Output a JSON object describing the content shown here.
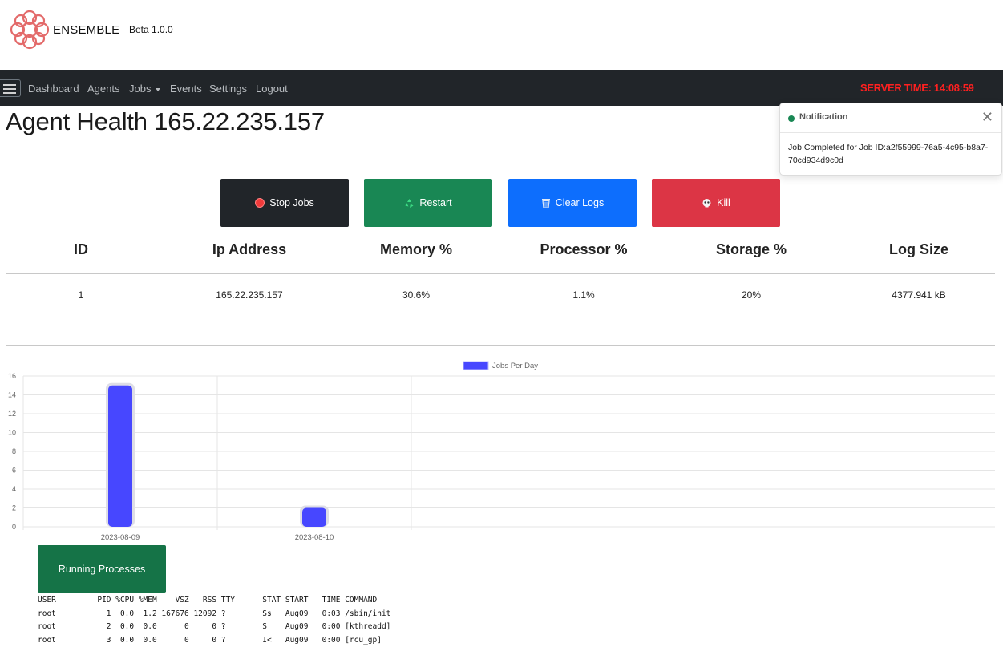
{
  "brand": {
    "name": "ENSEMBLE",
    "version": "Beta 1.0.0",
    "logo_icon": "celtic-knot-logo",
    "logo_color": "#e36a6a"
  },
  "nav": {
    "items": [
      "Dashboard",
      "Agents",
      "Jobs",
      "Events",
      "Settings",
      "Logout"
    ],
    "server_time": "SERVER TIME: 14:08:59",
    "server_time_color": "#ff2020"
  },
  "page": {
    "title": "Agent Health 165.22.235.157"
  },
  "notification": {
    "title": "Notification",
    "message": "Job Completed for Job ID:a2f55999-76a5-4c95-b8a7-70cd934d9c0d",
    "status_color": "#198754"
  },
  "actions": {
    "stop": "Stop Jobs",
    "restart": "Restart",
    "clear": "Clear Logs",
    "kill": "Kill"
  },
  "stats": {
    "headers": [
      "ID",
      "Ip Address",
      "Memory %",
      "Processor %",
      "Storage %",
      "Log Size"
    ],
    "row": [
      "1",
      "165.22.235.157",
      "30.6%",
      "1.1%",
      "20%",
      "4377.941 kB"
    ]
  },
  "chart_data": {
    "type": "bar",
    "categories": [
      "2023-08-09",
      "2023-08-10"
    ],
    "series": [
      {
        "name": "Jobs Per Day",
        "values": [
          15,
          2
        ],
        "color": "#4747ff"
      }
    ],
    "ylim": [
      0,
      16
    ],
    "yticks": [
      0,
      2,
      4,
      6,
      8,
      10,
      12,
      14,
      16
    ],
    "grid": true,
    "legend": "top-center"
  },
  "processes": {
    "button_label": "Running Processes",
    "lines": [
      "USER         PID %CPU %MEM    VSZ   RSS TTY      STAT START   TIME COMMAND",
      "root           1  0.0  1.2 167676 12092 ?        Ss   Aug09   0:03 /sbin/init",
      "root           2  0.0  0.0      0     0 ?        S    Aug09   0:00 [kthreadd]",
      "root           3  0.0  0.0      0     0 ?        I<   Aug09   0:00 [rcu_gp]"
    ]
  }
}
